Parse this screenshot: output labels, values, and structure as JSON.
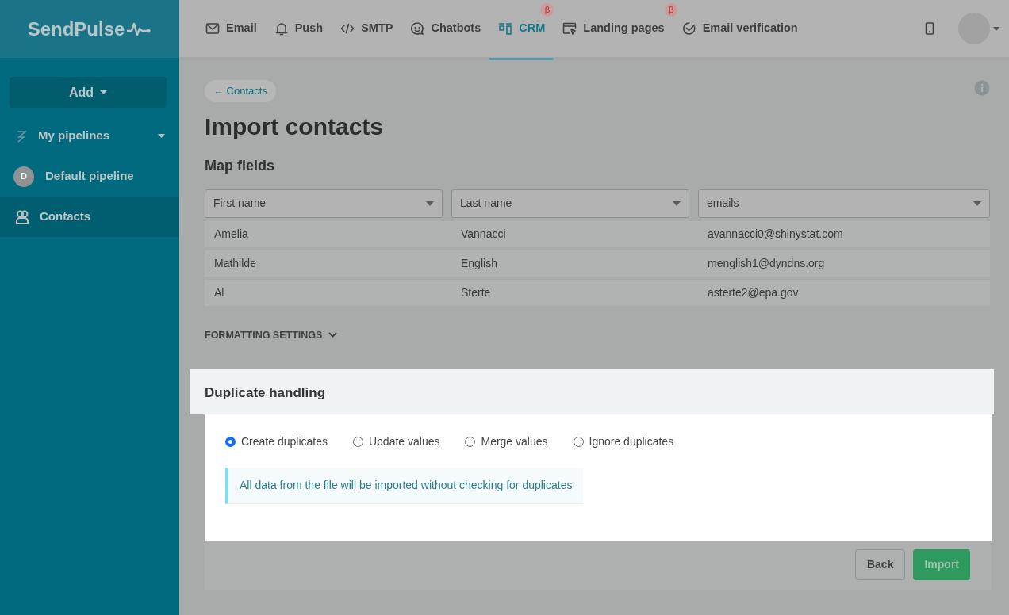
{
  "logo": {
    "text": "SendPulse"
  },
  "nav": {
    "items": [
      {
        "label": "Email",
        "kind": "envelope",
        "selected": false,
        "beta": false
      },
      {
        "label": "Push",
        "kind": "bell",
        "selected": false,
        "beta": false
      },
      {
        "label": "SMTP",
        "kind": "code",
        "selected": false,
        "beta": false
      },
      {
        "label": "Chatbots",
        "kind": "chat",
        "selected": false,
        "beta": false
      },
      {
        "label": "CRM",
        "kind": "crm",
        "selected": true,
        "beta": true,
        "beta_text": "β"
      },
      {
        "label": "Landing pages",
        "kind": "landing",
        "selected": false,
        "beta": true,
        "beta_text": "β"
      },
      {
        "label": "Email verification",
        "kind": "check",
        "selected": false,
        "beta": false
      }
    ]
  },
  "sidebar": {
    "add_button": "Add",
    "items": [
      {
        "kind": "group",
        "label": "My pipelines",
        "selected": false
      },
      {
        "kind": "pipeline",
        "label": "Default pipeline",
        "initial": "D",
        "selected": false
      },
      {
        "kind": "contacts",
        "label": "Contacts",
        "selected": true
      }
    ]
  },
  "back_link": "← Contacts",
  "title": "Import contacts",
  "map_fields": {
    "title": "Map fields",
    "selects": [
      "First name",
      "Last name",
      "emails"
    ],
    "rows": [
      [
        "Amelia",
        "Vannacci",
        "avannacci0@shinystat.com"
      ],
      [
        "Mathilde",
        "English",
        "menglish1@dyndns.org"
      ],
      [
        "Al",
        "Sterte",
        "asterte2@epa.gov"
      ]
    ]
  },
  "formatting_toggle": "FORMATTING SETTINGS",
  "duplicate_handling": {
    "title": "Duplicate handling",
    "options": [
      {
        "label": "Create duplicates",
        "selected": true
      },
      {
        "label": "Update values",
        "selected": false
      },
      {
        "label": "Merge values",
        "selected": false
      },
      {
        "label": "Ignore duplicates",
        "selected": false
      }
    ],
    "info": "All data from the file will be imported without checking for duplicates"
  },
  "buttons": [
    {
      "label": "Back",
      "kind": "secondary"
    },
    {
      "label": "Import",
      "kind": "primary"
    }
  ]
}
